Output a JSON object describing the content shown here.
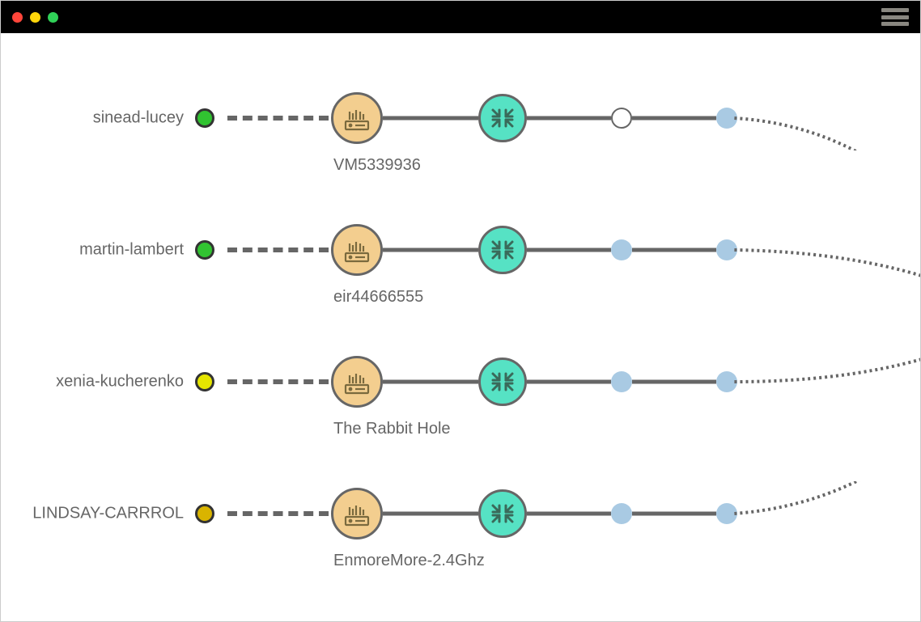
{
  "rows": [
    {
      "label": "sinead-lucey",
      "router": "VM5339936",
      "status": "green",
      "dotA": "hollow",
      "dotB": "blue"
    },
    {
      "label": "martin-lambert",
      "router": "eir44666555",
      "status": "green",
      "dotA": "blue",
      "dotB": "blue"
    },
    {
      "label": "xenia-kucherenko",
      "router": "The Rabbit Hole",
      "status": "yellow",
      "dotA": "blue",
      "dotB": "blue"
    },
    {
      "label": "LINDSAY-CARRROL",
      "router": "EnmoreMore-2.4Ghz",
      "status": "amber",
      "dotA": "blue",
      "dotB": "blue"
    }
  ]
}
